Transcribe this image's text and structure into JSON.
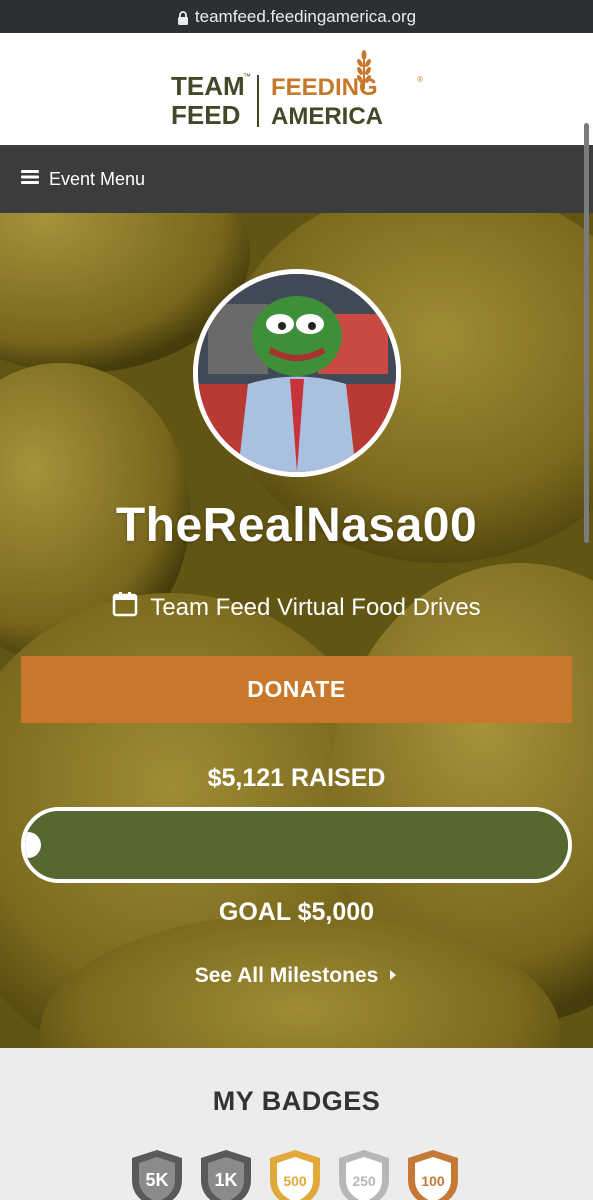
{
  "browser": {
    "url": "teamfeed.feedingamerica.org"
  },
  "logo": {
    "left_top": "TEAM",
    "left_bottom": "FEED",
    "right_top": "FEEDING",
    "right_bottom": "AMERICA",
    "trademark": "™",
    "registered": "®",
    "colors": {
      "team_green": "#414a28",
      "feeding_orange": "#c8782a",
      "america_green": "#414a28"
    }
  },
  "event_menu": {
    "label": "Event Menu",
    "icon": "hamburger-icon"
  },
  "hero": {
    "username": "TheRealNasa00",
    "event_icon": "calendar-icon",
    "event_name": "Team Feed Virtual Food Drives",
    "donate_label": "DONATE",
    "raised_text": "$5,121 RAISED",
    "progress_fraction": 1.0,
    "goal_text": "GOAL $5,000",
    "milestones_label": "See All Milestones",
    "milestones_icon": "caret-right-icon",
    "colors": {
      "donate": "#c8782a",
      "progress": "#56682f"
    }
  },
  "badges": {
    "title": "MY BADGES",
    "items": [
      {
        "label": "5K",
        "color": "#58595b"
      },
      {
        "label": "1K",
        "color": "#58595b"
      },
      {
        "label": "500",
        "color": "#e0a93a"
      },
      {
        "label": "250",
        "color": "#b7b7b7"
      },
      {
        "label": "100",
        "color": "#c47a36"
      }
    ]
  }
}
